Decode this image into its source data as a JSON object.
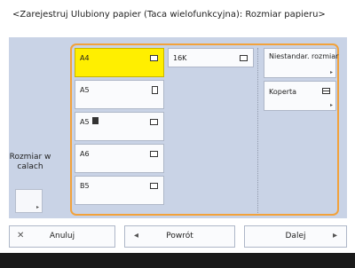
{
  "header": {
    "title": "<Zarejestruj Ulubiony papier (Taca wielofunkcyjna): Rozmiar papieru>"
  },
  "left": {
    "label": "Rozmiar w calach"
  },
  "papers": {
    "a4": "A4",
    "a5": "A5",
    "a5r": "A5",
    "a6": "A6",
    "b5": "B5",
    "k16": "16K"
  },
  "side": {
    "custom": "Niestandar. rozmiar",
    "envelope": "Koperta"
  },
  "buttons": {
    "cancel": "Anuluj",
    "back": "Powrót",
    "next": "Dalej"
  },
  "colors": {
    "selected": "#ffef00",
    "frame": "#f2a23b",
    "panel": "#c9d3e6"
  }
}
